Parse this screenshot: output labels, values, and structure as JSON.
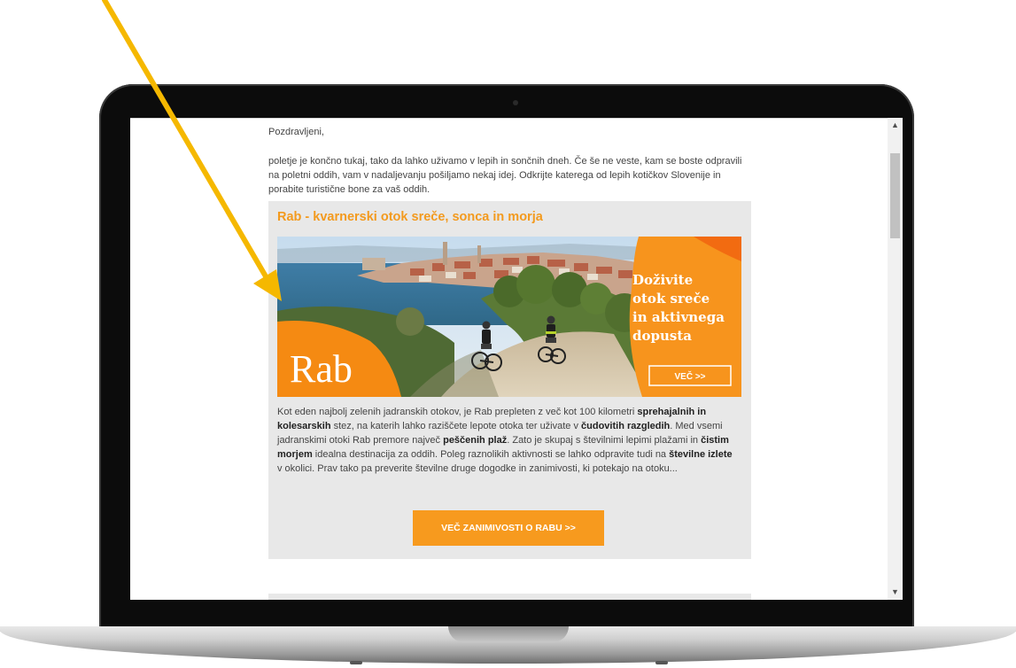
{
  "email": {
    "greeting": "Pozdravljeni,",
    "intro": "poletje je končno tukaj, tako da lahko uživamo v lepih in sončnih dneh. Če še ne veste, kam se boste odpravili na poletni oddih, vam v nadaljevanju pošiljamo nekaj idej. Odkrijte katerega od lepih kotičkov Slovenije in porabite turistične bone za vaš oddih.",
    "card": {
      "title": "Rab - kvarnerski otok sreče, sonca in morja",
      "banner": {
        "place": "Rab",
        "slogan": [
          "Doživite",
          "otok sreče",
          "in aktivnega",
          "dopusta"
        ],
        "button": "VEČ >>"
      },
      "text": [
        {
          "t": "Kot eden najbolj zelenih jadranskih otokov, je Rab prepleten z več kot 100 kilometri "
        },
        {
          "t": "sprehajalnih in kolesarskih",
          "b": true
        },
        {
          "t": " stez, na katerih lahko raziščete lepote otoka ter uživate v "
        },
        {
          "t": "čudovitih razgledih",
          "b": true
        },
        {
          "t": ". Med vsemi jadranskimi otoki Rab premore največ "
        },
        {
          "t": "peščenih plaž",
          "b": true
        },
        {
          "t": ". Zato je skupaj s številnimi lepimi plažami in "
        },
        {
          "t": "čistim morjem",
          "b": true
        },
        {
          "t": " idealna destinacija za oddih. Poleg raznolikih aktivnosti se lahko odpravite tudi na "
        },
        {
          "t": "številne izlete",
          "b": true
        },
        {
          "t": " v okolici. Prav tako pa preverite številne druge dogodke in zanimivosti, ki potekajo na otoku..."
        }
      ],
      "cta": "VEČ ZANIMIVOSTI O RABU >>"
    }
  },
  "colors": {
    "accent_orange": "#f39a1e",
    "card_bg": "#e8e8e8",
    "annotation_arrow": "#f5b800"
  },
  "icons": {
    "scroll_up": "▲",
    "scroll_down": "▼"
  }
}
